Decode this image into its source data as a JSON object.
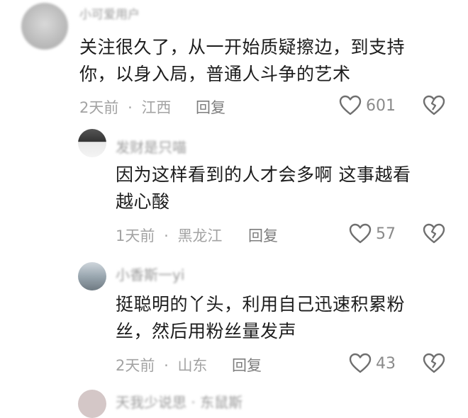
{
  "comments": [
    {
      "username": "小可爱用户",
      "content_line1": "关注很久了，从一开始质疑擦边，到支持",
      "content_line2": "你，以身入局，普通人斗争的艺术",
      "time": "2天前",
      "location": "江西",
      "reply_label": "回复",
      "likes": "601"
    },
    {
      "username": "发财是只喵",
      "content_line1": "因为这样看到的人才会多啊  这事越看",
      "content_line2": "越心酸",
      "time": "1天前",
      "location": "黑龙江",
      "reply_label": "回复",
      "likes": "57"
    },
    {
      "username": "小香斯一yi",
      "content_line1": "挺聪明的丫头，利用自己迅速积累粉",
      "content_line2": "丝，然后用粉丝量发声",
      "time": "2天前",
      "location": "山东",
      "reply_label": "回复",
      "likes": "43"
    },
    {
      "username": "天我少说思 · 东鼠斯"
    }
  ],
  "separator": "·",
  "colors": {
    "meta": "#a3a3a3",
    "reply": "#7d7d7d",
    "text": "#1c1c1c"
  },
  "icons": {
    "like": "heart-outline-icon",
    "dislike": "broken-heart-icon"
  }
}
